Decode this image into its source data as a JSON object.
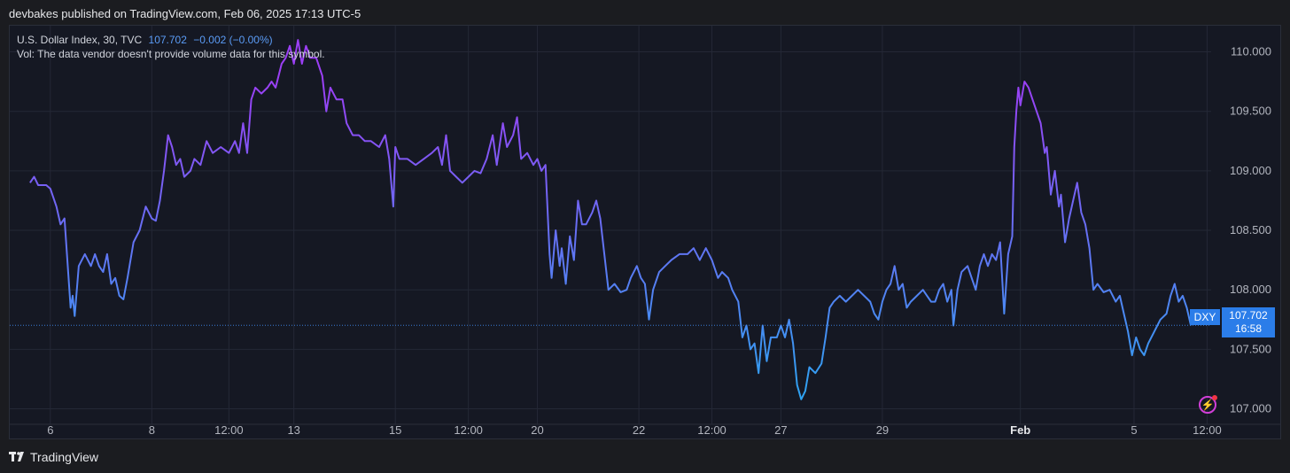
{
  "header": {
    "published": "devbakes published on TradingView.com, Feb 06, 2025 17:13 UTC-5"
  },
  "legend": {
    "symbol": "U.S. Dollar Index, 30, TVC",
    "last": "107.702",
    "change": "−0.002 (−0.00%)",
    "volume_note": "Vol: The data vendor doesn't provide volume data for this symbol."
  },
  "price_tag": {
    "symbol": "DXY",
    "price": "107.702",
    "countdown": "16:58"
  },
  "footer": {
    "brand": "TradingView"
  },
  "colors": {
    "line_start": "#9b3ff5",
    "line_end": "#2ea3f2",
    "background": "#151823",
    "grid": "#242836",
    "tag": "#2b7de9"
  },
  "chart_data": {
    "type": "line",
    "ylim": [
      106.87,
      110.22
    ],
    "y_ticks": [
      110.0,
      109.5,
      109.0,
      108.5,
      108.0,
      107.5,
      107.0
    ],
    "y_tick_labels": [
      "110.000",
      "109.500",
      "109.000",
      "108.500",
      "108.000",
      "107.500",
      "107.000"
    ],
    "x_range": [
      0,
      29.6
    ],
    "x_ticks": [
      {
        "x": 1.0,
        "label": "6",
        "bold": false
      },
      {
        "x": 3.5,
        "label": "8",
        "bold": false
      },
      {
        "x": 5.4,
        "label": "12:00",
        "bold": false
      },
      {
        "x": 7.0,
        "label": "13",
        "bold": false
      },
      {
        "x": 9.5,
        "label": "15",
        "bold": false
      },
      {
        "x": 11.3,
        "label": "12:00",
        "bold": false
      },
      {
        "x": 13.0,
        "label": "20",
        "bold": false
      },
      {
        "x": 15.5,
        "label": "22",
        "bold": false
      },
      {
        "x": 17.3,
        "label": "12:00",
        "bold": false
      },
      {
        "x": 19.0,
        "label": "27",
        "bold": false
      },
      {
        "x": 21.5,
        "label": "29",
        "bold": false
      },
      {
        "x": 24.9,
        "label": "Feb",
        "bold": true
      },
      {
        "x": 27.7,
        "label": "5",
        "bold": false
      },
      {
        "x": 29.5,
        "label": "12:00",
        "bold": false
      }
    ],
    "last_price": 107.702,
    "series": [
      {
        "values": [
          [
            0.5,
            108.9
          ],
          [
            0.6,
            108.95
          ],
          [
            0.7,
            108.88
          ],
          [
            0.9,
            108.88
          ],
          [
            1.0,
            108.85
          ],
          [
            1.15,
            108.7
          ],
          [
            1.25,
            108.55
          ],
          [
            1.35,
            108.6
          ],
          [
            1.45,
            108.1
          ],
          [
            1.5,
            107.85
          ],
          [
            1.55,
            107.95
          ],
          [
            1.6,
            107.78
          ],
          [
            1.7,
            108.2
          ],
          [
            1.85,
            108.3
          ],
          [
            2.0,
            108.2
          ],
          [
            2.1,
            108.3
          ],
          [
            2.2,
            108.2
          ],
          [
            2.3,
            108.15
          ],
          [
            2.4,
            108.3
          ],
          [
            2.5,
            108.05
          ],
          [
            2.6,
            108.1
          ],
          [
            2.7,
            107.95
          ],
          [
            2.8,
            107.92
          ],
          [
            2.9,
            108.1
          ],
          [
            3.05,
            108.4
          ],
          [
            3.2,
            108.5
          ],
          [
            3.35,
            108.7
          ],
          [
            3.5,
            108.6
          ],
          [
            3.6,
            108.58
          ],
          [
            3.7,
            108.75
          ],
          [
            3.8,
            109.0
          ],
          [
            3.9,
            109.3
          ],
          [
            4.0,
            109.2
          ],
          [
            4.1,
            109.05
          ],
          [
            4.2,
            109.1
          ],
          [
            4.3,
            108.95
          ],
          [
            4.45,
            109.0
          ],
          [
            4.55,
            109.1
          ],
          [
            4.7,
            109.05
          ],
          [
            4.85,
            109.25
          ],
          [
            5.0,
            109.15
          ],
          [
            5.2,
            109.2
          ],
          [
            5.4,
            109.15
          ],
          [
            5.55,
            109.25
          ],
          [
            5.65,
            109.15
          ],
          [
            5.75,
            109.4
          ],
          [
            5.85,
            109.15
          ],
          [
            5.95,
            109.6
          ],
          [
            6.05,
            109.7
          ],
          [
            6.2,
            109.65
          ],
          [
            6.35,
            109.7
          ],
          [
            6.45,
            109.75
          ],
          [
            6.55,
            109.7
          ],
          [
            6.7,
            109.9
          ],
          [
            6.8,
            109.95
          ],
          [
            6.9,
            110.05
          ],
          [
            7.0,
            109.9
          ],
          [
            7.1,
            110.1
          ],
          [
            7.2,
            109.9
          ],
          [
            7.3,
            110.05
          ],
          [
            7.4,
            109.95
          ],
          [
            7.55,
            109.95
          ],
          [
            7.7,
            109.8
          ],
          [
            7.8,
            109.5
          ],
          [
            7.9,
            109.7
          ],
          [
            8.05,
            109.6
          ],
          [
            8.2,
            109.6
          ],
          [
            8.3,
            109.4
          ],
          [
            8.45,
            109.3
          ],
          [
            8.6,
            109.3
          ],
          [
            8.75,
            109.25
          ],
          [
            8.9,
            109.25
          ],
          [
            9.1,
            109.2
          ],
          [
            9.25,
            109.3
          ],
          [
            9.35,
            109.1
          ],
          [
            9.45,
            108.7
          ],
          [
            9.5,
            109.2
          ],
          [
            9.6,
            109.1
          ],
          [
            9.8,
            109.1
          ],
          [
            10.0,
            109.05
          ],
          [
            10.2,
            109.1
          ],
          [
            10.4,
            109.15
          ],
          [
            10.55,
            109.2
          ],
          [
            10.65,
            109.05
          ],
          [
            10.75,
            109.3
          ],
          [
            10.85,
            109.0
          ],
          [
            11.0,
            108.95
          ],
          [
            11.15,
            108.9
          ],
          [
            11.3,
            108.95
          ],
          [
            11.45,
            109.0
          ],
          [
            11.6,
            108.98
          ],
          [
            11.75,
            109.1
          ],
          [
            11.9,
            109.3
          ],
          [
            12.0,
            109.05
          ],
          [
            12.15,
            109.4
          ],
          [
            12.25,
            109.2
          ],
          [
            12.4,
            109.3
          ],
          [
            12.5,
            109.45
          ],
          [
            12.6,
            109.1
          ],
          [
            12.75,
            109.15
          ],
          [
            12.9,
            109.05
          ],
          [
            13.0,
            109.1
          ],
          [
            13.1,
            109.0
          ],
          [
            13.2,
            109.05
          ],
          [
            13.3,
            108.3
          ],
          [
            13.35,
            108.1
          ],
          [
            13.45,
            108.5
          ],
          [
            13.55,
            108.2
          ],
          [
            13.6,
            108.35
          ],
          [
            13.7,
            108.05
          ],
          [
            13.8,
            108.45
          ],
          [
            13.9,
            108.25
          ],
          [
            14.0,
            108.75
          ],
          [
            14.1,
            108.55
          ],
          [
            14.2,
            108.55
          ],
          [
            14.35,
            108.65
          ],
          [
            14.45,
            108.75
          ],
          [
            14.55,
            108.6
          ],
          [
            14.65,
            108.3
          ],
          [
            14.75,
            108.0
          ],
          [
            14.9,
            108.05
          ],
          [
            15.05,
            107.98
          ],
          [
            15.2,
            108.0
          ],
          [
            15.3,
            108.1
          ],
          [
            15.45,
            108.2
          ],
          [
            15.55,
            108.1
          ],
          [
            15.65,
            108.05
          ],
          [
            15.75,
            107.75
          ],
          [
            15.85,
            108.0
          ],
          [
            16.0,
            108.15
          ],
          [
            16.15,
            108.2
          ],
          [
            16.3,
            108.25
          ],
          [
            16.5,
            108.3
          ],
          [
            16.7,
            108.3
          ],
          [
            16.85,
            108.35
          ],
          [
            17.0,
            108.25
          ],
          [
            17.15,
            108.35
          ],
          [
            17.3,
            108.25
          ],
          [
            17.45,
            108.1
          ],
          [
            17.55,
            108.15
          ],
          [
            17.7,
            108.1
          ],
          [
            17.8,
            108.0
          ],
          [
            17.95,
            107.9
          ],
          [
            18.05,
            107.6
          ],
          [
            18.15,
            107.7
          ],
          [
            18.25,
            107.5
          ],
          [
            18.35,
            107.55
          ],
          [
            18.45,
            107.3
          ],
          [
            18.55,
            107.7
          ],
          [
            18.65,
            107.4
          ],
          [
            18.75,
            107.6
          ],
          [
            18.9,
            107.6
          ],
          [
            19.0,
            107.7
          ],
          [
            19.1,
            107.6
          ],
          [
            19.2,
            107.75
          ],
          [
            19.3,
            107.55
          ],
          [
            19.4,
            107.2
          ],
          [
            19.5,
            107.08
          ],
          [
            19.6,
            107.15
          ],
          [
            19.7,
            107.35
          ],
          [
            19.85,
            107.3
          ],
          [
            20.0,
            107.38
          ],
          [
            20.1,
            107.6
          ],
          [
            20.2,
            107.85
          ],
          [
            20.3,
            107.9
          ],
          [
            20.45,
            107.95
          ],
          [
            20.6,
            107.9
          ],
          [
            20.75,
            107.95
          ],
          [
            20.9,
            108.0
          ],
          [
            21.05,
            107.95
          ],
          [
            21.2,
            107.9
          ],
          [
            21.3,
            107.8
          ],
          [
            21.4,
            107.75
          ],
          [
            21.5,
            107.9
          ],
          [
            21.6,
            108.0
          ],
          [
            21.7,
            108.05
          ],
          [
            21.8,
            108.2
          ],
          [
            21.9,
            108.0
          ],
          [
            22.0,
            108.05
          ],
          [
            22.1,
            107.85
          ],
          [
            22.2,
            107.9
          ],
          [
            22.35,
            107.95
          ],
          [
            22.5,
            108.0
          ],
          [
            22.6,
            107.95
          ],
          [
            22.7,
            107.9
          ],
          [
            22.8,
            107.9
          ],
          [
            22.9,
            108.0
          ],
          [
            23.0,
            108.05
          ],
          [
            23.1,
            107.9
          ],
          [
            23.2,
            108.0
          ],
          [
            23.25,
            107.7
          ],
          [
            23.35,
            108.0
          ],
          [
            23.45,
            108.15
          ],
          [
            23.6,
            108.2
          ],
          [
            23.7,
            108.1
          ],
          [
            23.8,
            108.0
          ],
          [
            23.9,
            108.2
          ],
          [
            24.0,
            108.3
          ],
          [
            24.1,
            108.2
          ],
          [
            24.2,
            108.3
          ],
          [
            24.3,
            108.25
          ],
          [
            24.4,
            108.4
          ],
          [
            24.5,
            107.8
          ],
          [
            24.6,
            108.3
          ],
          [
            24.7,
            108.45
          ],
          [
            24.75,
            109.2
          ],
          [
            24.8,
            109.5
          ],
          [
            24.85,
            109.7
          ],
          [
            24.9,
            109.55
          ],
          [
            25.0,
            109.75
          ],
          [
            25.1,
            109.7
          ],
          [
            25.2,
            109.6
          ],
          [
            25.3,
            109.5
          ],
          [
            25.4,
            109.4
          ],
          [
            25.5,
            109.15
          ],
          [
            25.55,
            109.2
          ],
          [
            25.65,
            108.8
          ],
          [
            25.75,
            109.0
          ],
          [
            25.85,
            108.7
          ],
          [
            25.9,
            108.8
          ],
          [
            26.0,
            108.4
          ],
          [
            26.1,
            108.6
          ],
          [
            26.2,
            108.75
          ],
          [
            26.3,
            108.9
          ],
          [
            26.4,
            108.65
          ],
          [
            26.5,
            108.55
          ],
          [
            26.6,
            108.35
          ],
          [
            26.7,
            108.0
          ],
          [
            26.8,
            108.05
          ],
          [
            26.95,
            107.98
          ],
          [
            27.1,
            108.0
          ],
          [
            27.25,
            107.9
          ],
          [
            27.35,
            107.95
          ],
          [
            27.45,
            107.8
          ],
          [
            27.55,
            107.65
          ],
          [
            27.65,
            107.45
          ],
          [
            27.75,
            107.6
          ],
          [
            27.85,
            107.5
          ],
          [
            27.95,
            107.45
          ],
          [
            28.05,
            107.55
          ],
          [
            28.2,
            107.65
          ],
          [
            28.35,
            107.75
          ],
          [
            28.5,
            107.8
          ],
          [
            28.6,
            107.95
          ],
          [
            28.7,
            108.05
          ],
          [
            28.8,
            107.9
          ],
          [
            28.9,
            107.95
          ],
          [
            29.0,
            107.85
          ],
          [
            29.1,
            107.7
          ]
        ]
      }
    ]
  }
}
